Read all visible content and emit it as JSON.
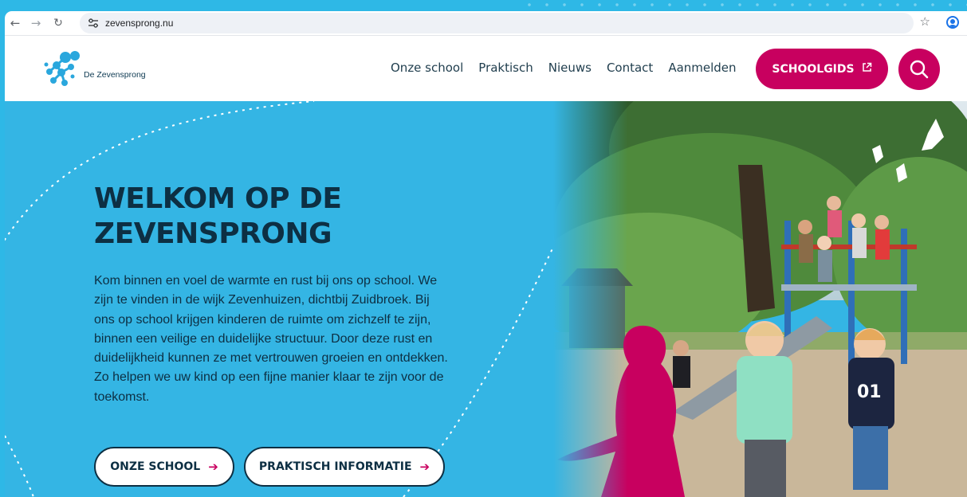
{
  "browser": {
    "back_icon": "arrow-left-icon",
    "forward_icon": "arrow-right-icon",
    "reload_icon": "reload-icon",
    "site_info_icon": "tune-icon",
    "url": "zevensprong.nu",
    "bookmark_icon": "star-icon",
    "profile_icon": "account-circle-icon"
  },
  "header": {
    "logo_text": "De Zevensprong",
    "nav": [
      "Onze school",
      "Praktisch",
      "Nieuws",
      "Contact",
      "Aanmelden"
    ],
    "schoolgids_label": "SCHOOLGIDS",
    "schoolgids_icon": "external-link-icon",
    "search_icon": "search-icon"
  },
  "hero": {
    "title": "WELKOM OP DE ZEVENSPRONG",
    "text": "Kom binnen en voel de warmte en rust bij ons op school. We zijn te vinden in de wijk Zevenhuizen, dichtbij Zuidbroek. Bij ons op school krijgen kinderen de ruimte om zichzelf te zijn, binnen een veilige en duidelijke structuur. Door deze rust en duidelijkheid kunnen ze met vertrouwen groeien en ontdekken. Zo helpen we uw kind op een fijne manier klaar te zijn voor de toekomst.",
    "cta_primary": "ONZE SCHOOL",
    "cta_secondary": "PRAKTISCH INFORMATIE",
    "cta_icon": "arrow-right-icon"
  },
  "colors": {
    "brand_blue": "#34b5e4",
    "brand_magenta": "#c8005f",
    "text_dark": "#0d2f43"
  }
}
